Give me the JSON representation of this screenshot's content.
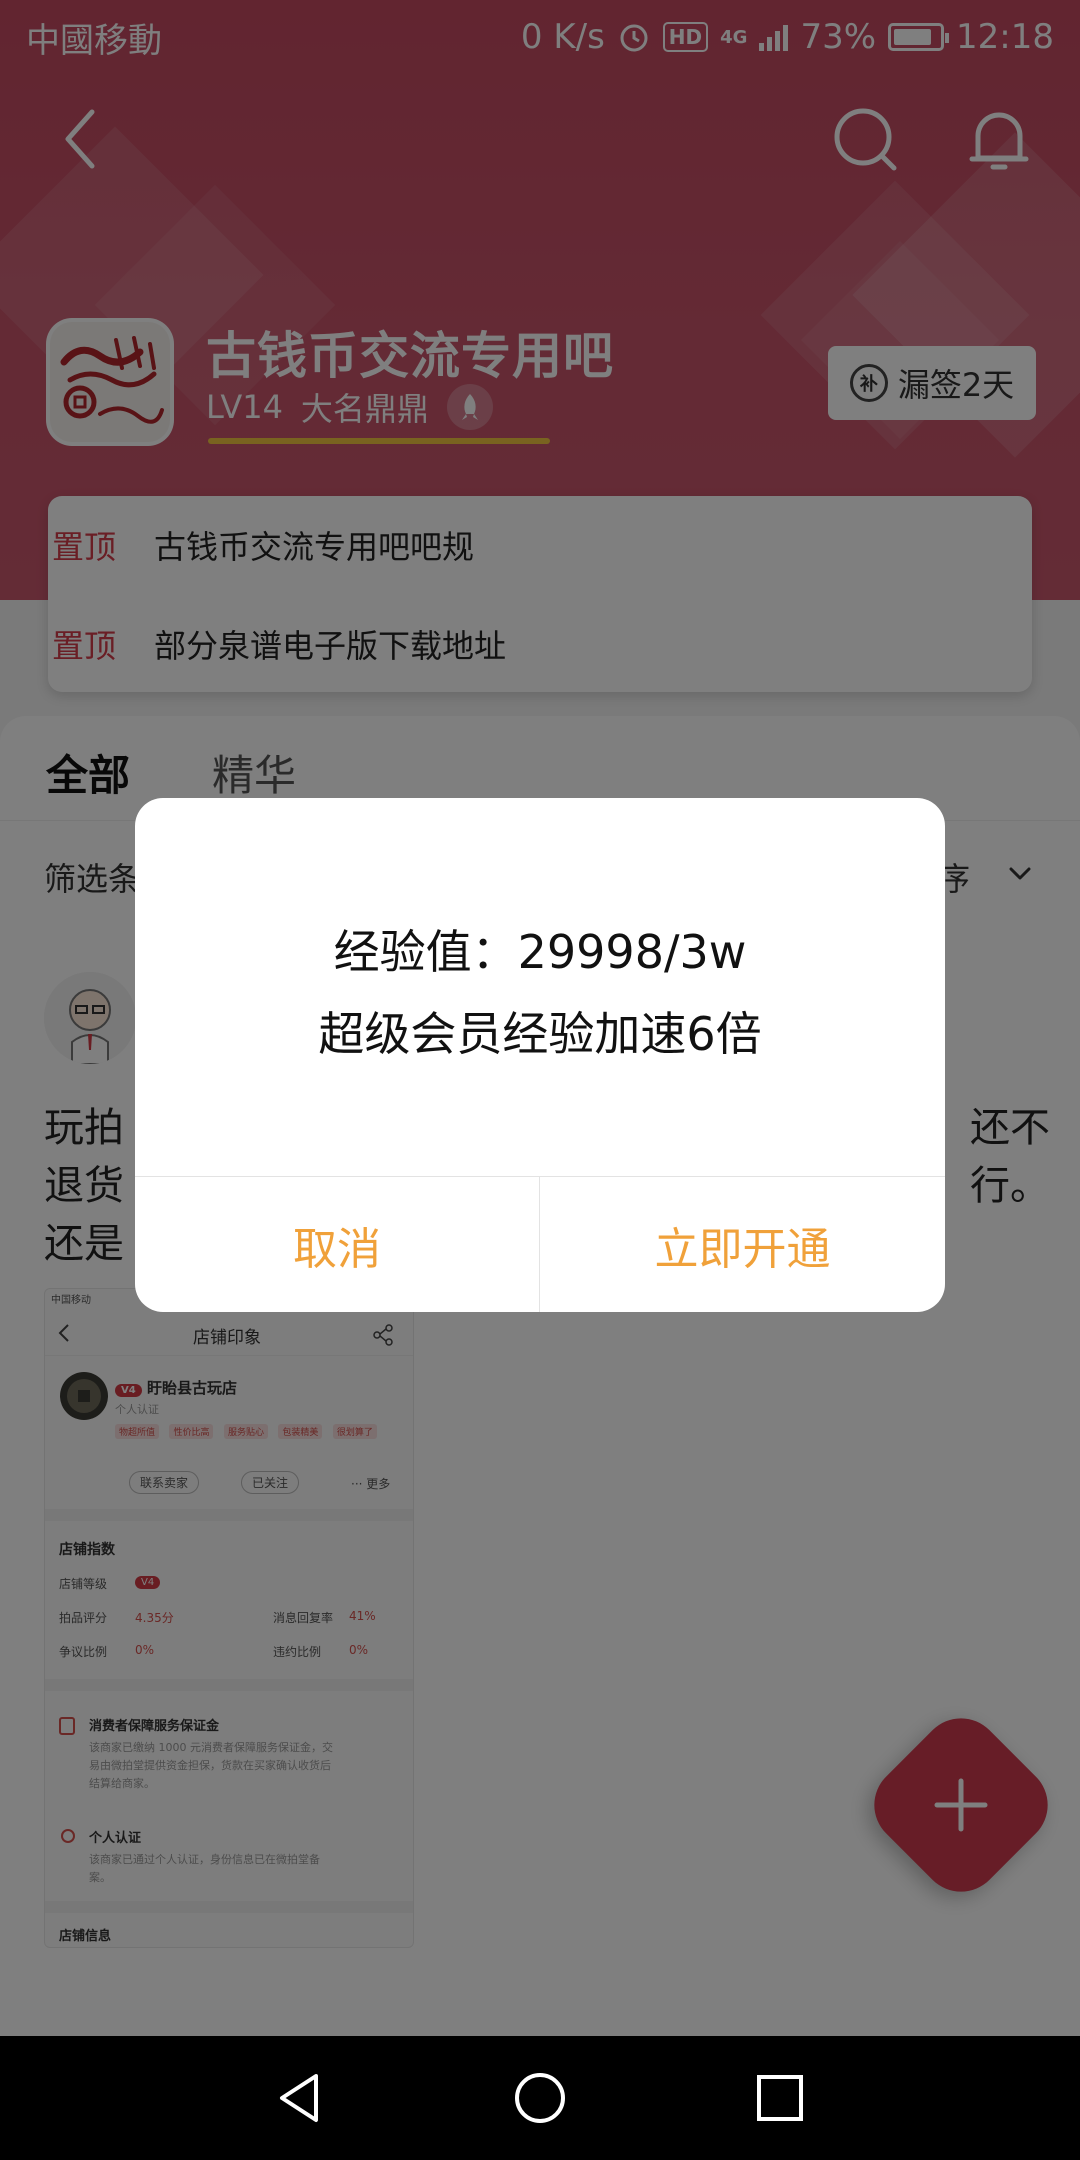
{
  "status_bar": {
    "carrier": "中國移動",
    "speed": "0 K/s",
    "hd": "HD",
    "network": "4G",
    "battery": "73%",
    "time": "12:18"
  },
  "forum": {
    "name": "古钱币交流专用吧",
    "level": "LV14",
    "rank": "大名鼎鼎",
    "sign_label": "漏签2天",
    "sign_icon_text": "补"
  },
  "pinned": [
    {
      "tag": "置顶",
      "title": "古钱币交流专用吧吧规"
    },
    {
      "tag": "置顶",
      "title": "部分泉谱电子版下载地址"
    }
  ],
  "tabs": {
    "all": "全部",
    "best": "精华"
  },
  "filter": {
    "label": "筛选条",
    "sort": "序"
  },
  "post": {
    "line1_left": "玩拍",
    "line1_right": "还不",
    "line2_left": "退货",
    "line2_right": "行。",
    "line3_left": "还是"
  },
  "screenshot": {
    "status_carrier": "中国移动",
    "title": "店铺印象",
    "shop_name": "盱眙县古玩店",
    "level_badge": "V4",
    "cert": "个人认证",
    "tags": [
      "物超所值",
      "性价比高",
      "服务贴心",
      "包装精美",
      "很划算了"
    ],
    "contact_btn": "联系卖家",
    "follow_btn": "已关注",
    "more": "··· 更多",
    "index_title": "店铺指数",
    "shop_level_label": "店铺等级",
    "score_label": "拍品评分",
    "score_value": "4.35分",
    "reply_label": "消息回复率",
    "reply_value": "41%",
    "dispute_label": "争议比例",
    "dispute_value": "0%",
    "violation_label": "违约比例",
    "violation_value": "0%",
    "deposit_title": "消费者保障服务保证金",
    "deposit_text1": "该商家已缴纳 1000 元消费者保障服务保证金，交",
    "deposit_text2": "易由微拍堂提供资金担保，货款在买家确认收货后",
    "deposit_text3": "结算给商家。",
    "personal_title": "个人认证",
    "personal_text1": "该商家已通过个人认证，身份信息已在微拍堂备",
    "personal_text2": "案。",
    "shop_info": "店铺信息"
  },
  "dialog": {
    "line1": "经验值：29998/3w",
    "line2": "超级会员经验加速6倍",
    "cancel": "取消",
    "confirm": "立即开通"
  },
  "colors": {
    "header": "#c44a61",
    "accent_red": "#d53c4b",
    "dialog_button": "#f0a13a",
    "level_bar": "#f3c640"
  },
  "icons": [
    "back-icon",
    "search-icon",
    "bell-icon",
    "rocket-icon",
    "sign-icon",
    "fab-plus-icon",
    "nav-back-icon",
    "nav-home-icon",
    "nav-recent-icon"
  ]
}
